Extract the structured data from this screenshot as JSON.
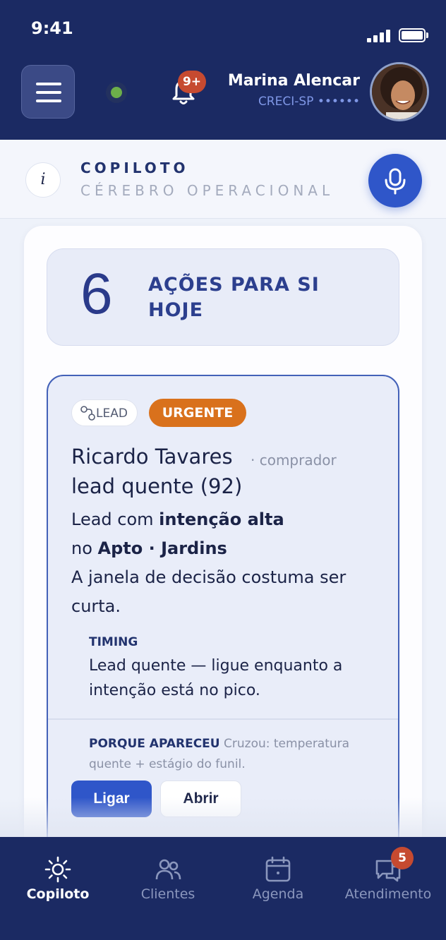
{
  "status_bar": {
    "time": "9:41"
  },
  "header": {
    "notifications_badge": "9+",
    "user_name": "Marina Alencar",
    "user_sub": "CRECI-SP ••••••"
  },
  "copilot": {
    "title": "COPILOTO",
    "subtitle": "CÉREBRO OPERACIONAL",
    "info_label": "i"
  },
  "summary": {
    "count": "6",
    "label": "AÇÕES PARA SI HOJE"
  },
  "lead": {
    "tag_type": "LEAD",
    "tag_priority": "URGENTE",
    "name": "Ricardo Tavares",
    "role": "· comprador",
    "score": "lead quente (92)",
    "line1_prefix": "Lead com ",
    "line1_bold": "intenção alta",
    "line2_prefix": "no ",
    "line2_bold": "Apto · Jardins",
    "line3": "A janela de decisão costuma ser",
    "line4": "curta.",
    "timing_title": "TIMING",
    "timing_line1": "Lead quente — ligue enquanto a",
    "timing_line2": "intenção está no pico.",
    "why_title": "PORQUE APARECEU",
    "why_text": "Cruzou: temperatura quente + estágio do funil.",
    "btn_call": "Ligar",
    "btn_open": "Abrir"
  },
  "bottom_nav": {
    "items": [
      {
        "label": "Copiloto",
        "icon": "sun-icon",
        "active": true
      },
      {
        "label": "Clientes",
        "icon": "users-icon",
        "active": false
      },
      {
        "label": "Agenda",
        "icon": "calendar-icon",
        "active": false
      },
      {
        "label": "Atendimento",
        "icon": "chat-icon",
        "active": false,
        "badge": "5"
      }
    ]
  },
  "colors": {
    "navy": "#1b2a63",
    "accent_blue": "#2f56c9",
    "urgent_orange": "#d9711c",
    "badge_red": "#c64a30",
    "online_green": "#6cae4a"
  }
}
